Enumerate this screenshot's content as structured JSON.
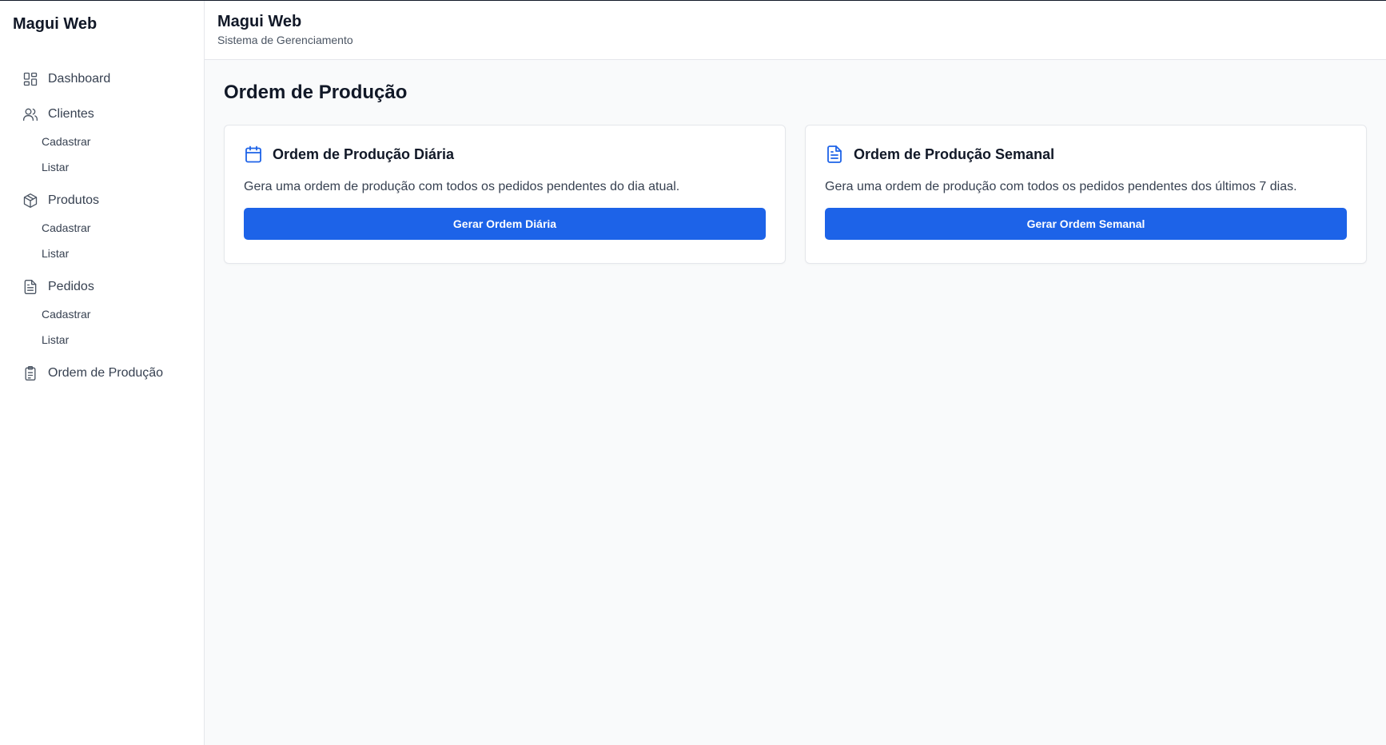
{
  "sidebar": {
    "brand": "Magui Web",
    "items": [
      {
        "label": "Dashboard",
        "icon": "dashboard-icon"
      },
      {
        "label": "Clientes",
        "icon": "users-icon",
        "sub": [
          "Cadastrar",
          "Listar"
        ]
      },
      {
        "label": "Produtos",
        "icon": "box-icon",
        "sub": [
          "Cadastrar",
          "Listar"
        ]
      },
      {
        "label": "Pedidos",
        "icon": "file-text-icon",
        "sub": [
          "Cadastrar",
          "Listar"
        ]
      },
      {
        "label": "Ordem de Produção",
        "icon": "clipboard-icon"
      }
    ]
  },
  "header": {
    "title": "Magui Web",
    "subtitle": "Sistema de Gerenciamento"
  },
  "main": {
    "title": "Ordem de Produção",
    "cards": [
      {
        "icon": "calendar-icon",
        "title": "Ordem de Produção Diária",
        "description": "Gera uma ordem de produção com todos os pedidos pendentes do dia atual.",
        "button": "Gerar Ordem Diária"
      },
      {
        "icon": "document-icon",
        "title": "Ordem de Produção Semanal",
        "description": "Gera uma ordem de produção com todos os pedidos pendentes dos últimos 7 dias.",
        "button": "Gerar Ordem Semanal"
      }
    ]
  },
  "colors": {
    "accent": "#1d63e8",
    "background": "#f9fafb",
    "border": "#e5e7eb"
  }
}
